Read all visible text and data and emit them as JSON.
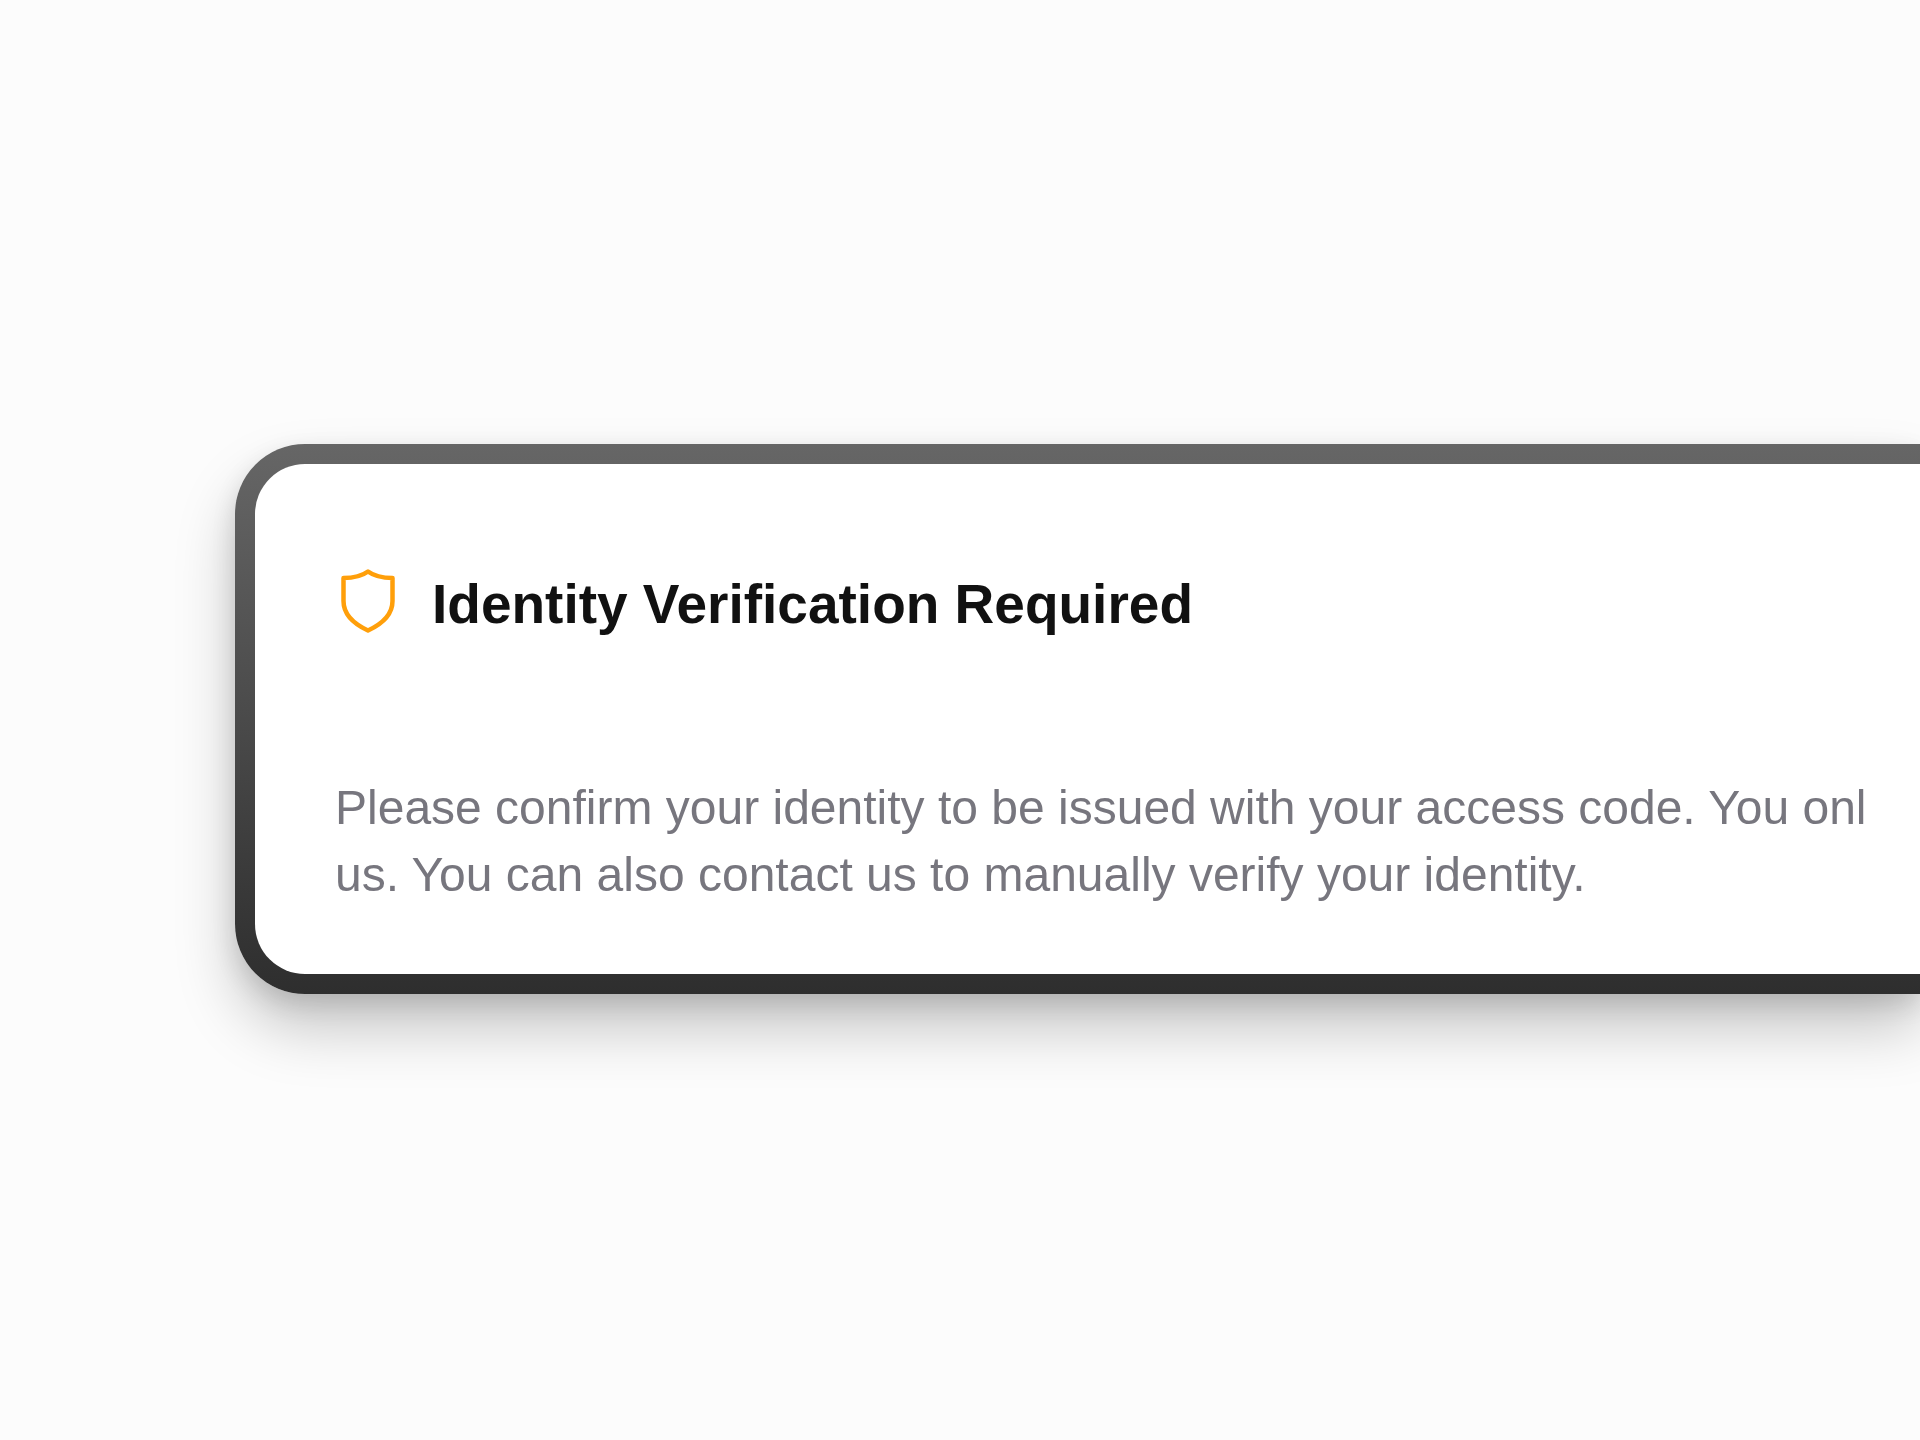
{
  "dialog": {
    "title": "Identity Verification Required",
    "message_lines": [
      "Please confirm your identity to be issued with your access code. You onl",
      "us. You can also contact us to manually verify your identity."
    ]
  }
}
